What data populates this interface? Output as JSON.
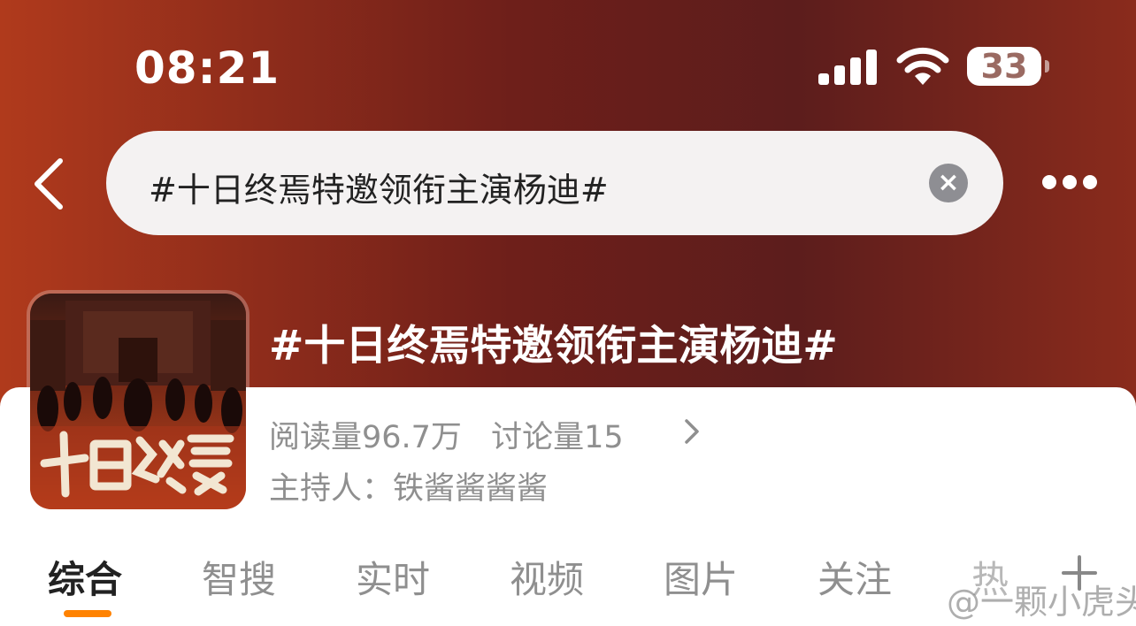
{
  "status_bar": {
    "time": "08:21",
    "battery": "33"
  },
  "search": {
    "query": "#十日终焉特邀领衔主演杨迪#"
  },
  "topic": {
    "title": "#十日终焉特邀领衔主演杨迪#",
    "reads": "阅读量96.7万",
    "discussions": "讨论量15",
    "host": "主持人：铁酱酱酱酱",
    "cover_text": "十日终焉"
  },
  "tabs": [
    "综合",
    "智搜",
    "实时",
    "视频",
    "图片",
    "关注",
    "热"
  ],
  "watermark": "@一颗小虎头",
  "colors": {
    "accent": "#ff8200",
    "header_dark": "#5c1d1c",
    "header_light": "#b03a1c"
  }
}
